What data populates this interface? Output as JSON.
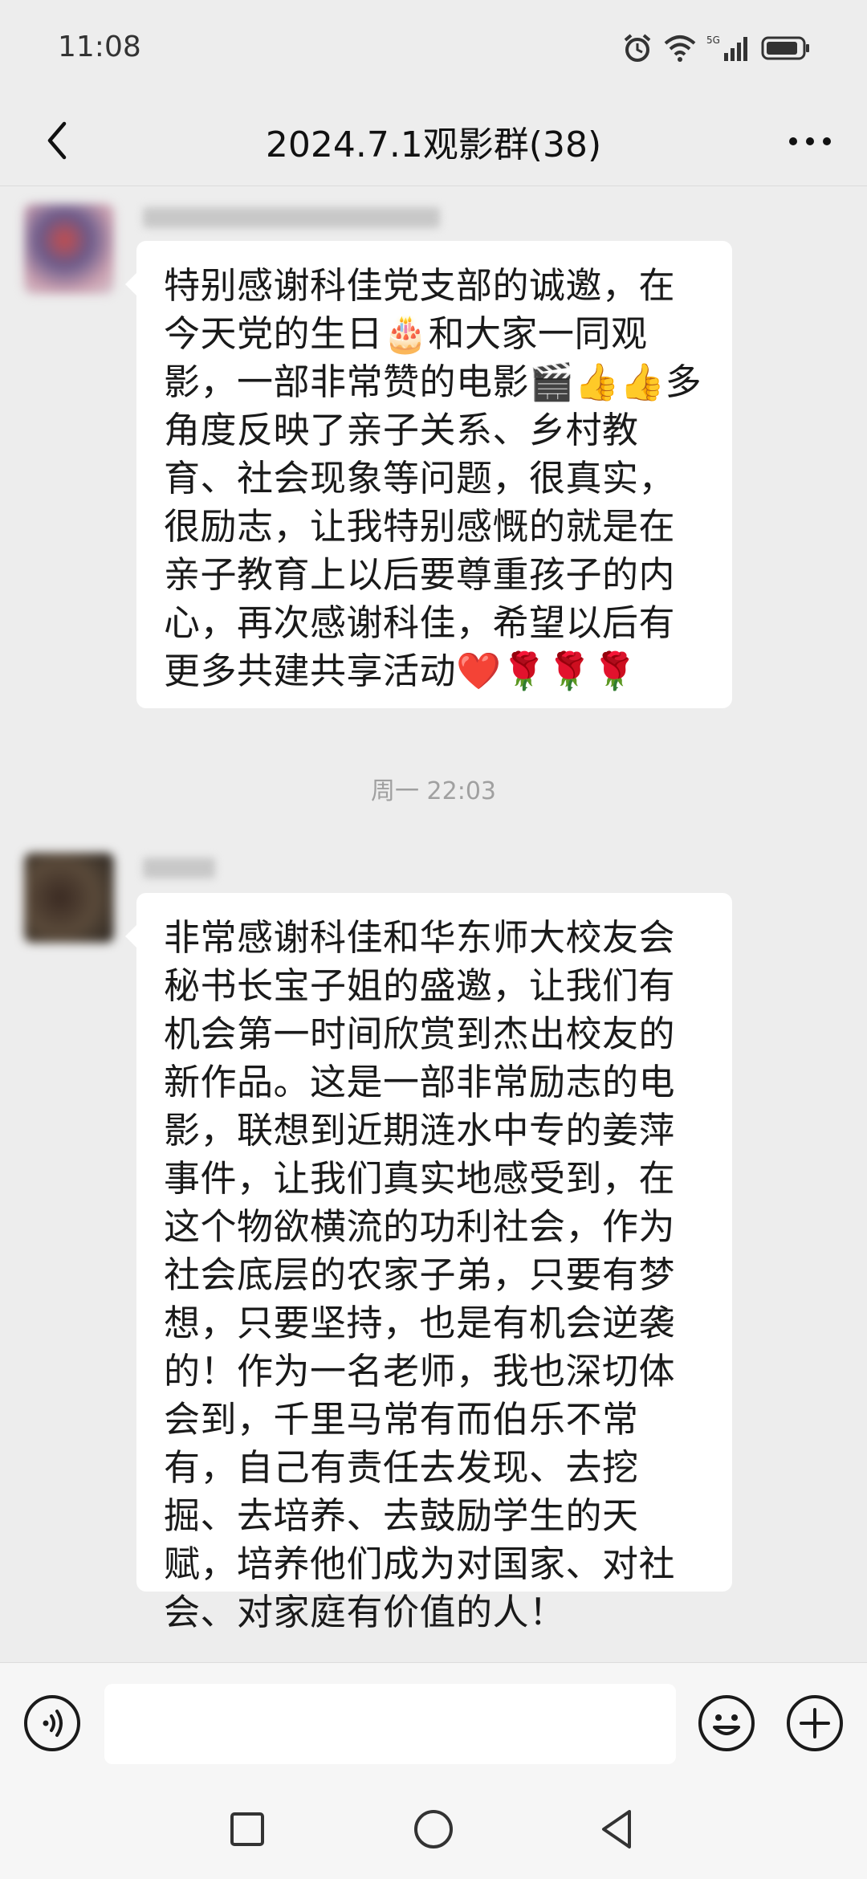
{
  "status": {
    "time": "11:08",
    "network": "5G"
  },
  "header": {
    "title": "2024.7.1观影群(38)"
  },
  "messages": [
    {
      "text": "特别感谢科佳党支部的诚邀，在今天党的生日🎂和大家一同观影，一部非常赞的电影🎬👍👍多角度反映了亲子关系、乡村教育、社会现象等问题，很真实，很励志，让我特别感慨的就是在亲子教育上以后要尊重孩子的内心，再次感谢科佳，希望以后有更多共建共享活动❤️🌹🌹🌹"
    },
    {
      "text": "非常感谢科佳和华东师大校友会秘书长宝子姐的盛邀，让我们有机会第一时间欣赏到杰出校友的新作品。这是一部非常励志的电影，联想到近期涟水中专的姜萍事件，让我们真实地感受到，在这个物欲横流的功利社会，作为社会底层的农家子弟，只要有梦想，只要坚持，也是有机会逆袭的！作为一名老师，我也深切体会到，千里马常有而伯乐不常有，自己有责任去发现、去挖掘、去培养、去鼓励学生的天赋，培养他们成为对国家、对社会、对家庭有价值的人！"
    }
  ],
  "timestamps": {
    "t1": "周一 22:03"
  },
  "icons": {
    "back": "chevron-left-icon",
    "more": "more-dots-icon",
    "voice": "voice-icon",
    "emoji": "emoji-icon",
    "plus": "plus-icon"
  },
  "colors": {
    "background": "#ededed",
    "bubble": "#ffffff",
    "timestamp": "#a0a0a0"
  }
}
